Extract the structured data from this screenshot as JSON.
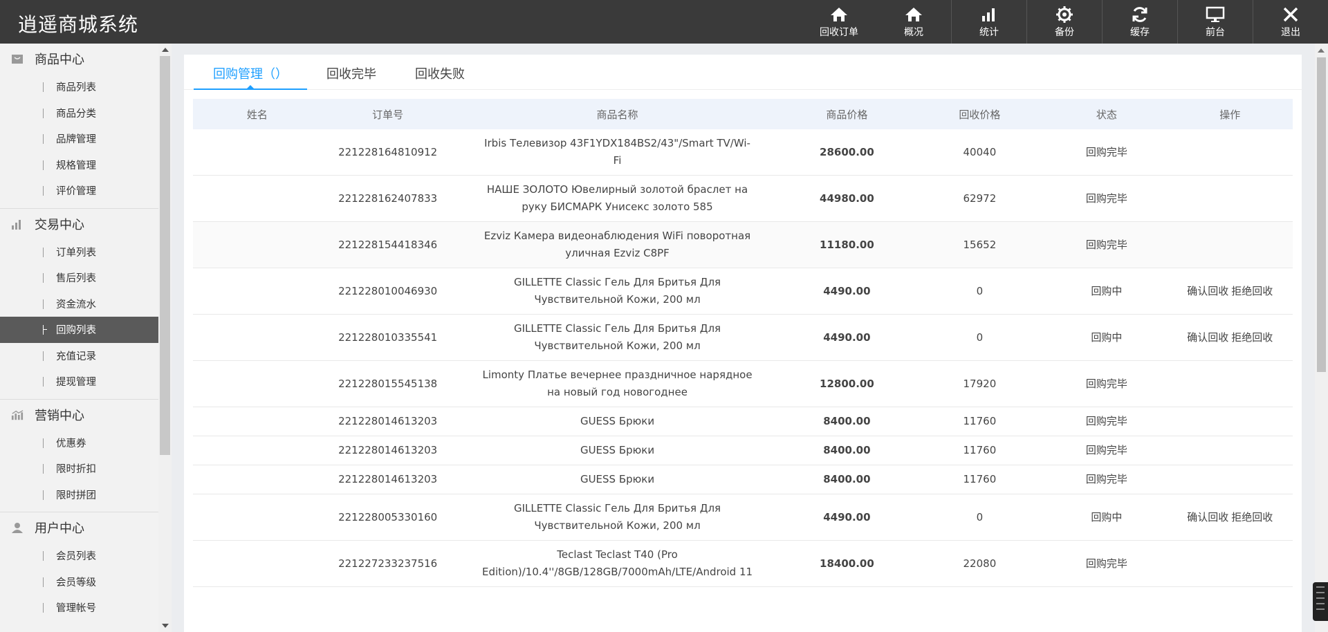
{
  "app": {
    "title": "逍遥商城系统"
  },
  "topnav": [
    {
      "label": "回收订单",
      "icon": "home-icon"
    },
    {
      "label": "概况",
      "icon": "home-icon"
    },
    {
      "label": "统计",
      "icon": "bar-chart-icon"
    },
    {
      "label": "备份",
      "icon": "gear-icon"
    },
    {
      "label": "缓存",
      "icon": "refresh-icon"
    },
    {
      "label": "前台",
      "icon": "monitor-icon"
    },
    {
      "label": "退出",
      "icon": "close-icon"
    }
  ],
  "sidebar": {
    "groups": [
      {
        "title": "商品中心",
        "icon": "bag-icon",
        "items": [
          "商品列表",
          "商品分类",
          "品牌管理",
          "规格管理",
          "评价管理"
        ]
      },
      {
        "title": "交易中心",
        "icon": "bar-chart-icon",
        "items": [
          "订单列表",
          "售后列表",
          "资金流水",
          "回购列表",
          "充值记录",
          "提现管理"
        ]
      },
      {
        "title": "营销中心",
        "icon": "growth-chart-icon",
        "items": [
          "优惠券",
          "限时折扣",
          "限时拼团"
        ]
      },
      {
        "title": "用户中心",
        "icon": "user-icon",
        "items": [
          "会员列表",
          "会员等级",
          "管理帐号"
        ]
      }
    ],
    "active_item": "回购列表"
  },
  "tabs": [
    {
      "label": "回购管理（）",
      "active": true
    },
    {
      "label": "回收完毕",
      "active": false
    },
    {
      "label": "回收失败",
      "active": false
    }
  ],
  "table": {
    "headers": [
      "姓名",
      "订单号",
      "商品名称",
      "商品价格",
      "回收价格",
      "状态",
      "操作"
    ],
    "rows": [
      {
        "name": "",
        "order_no": "221228164810912",
        "product": "Irbis Телевизор 43F1YDX184BS2/43\"/Smart TV/Wi-Fi",
        "price": "28600.00",
        "recycle_price": "40040",
        "status": "回购完毕",
        "confirm": "",
        "reject": ""
      },
      {
        "name": "",
        "order_no": "221228162407833",
        "product": "НАШЕ ЗОЛОТО Ювелирный золотой браслет на руку БИСМАРК Унисекс золото 585",
        "price": "44980.00",
        "recycle_price": "62972",
        "status": "回购完毕",
        "confirm": "",
        "reject": ""
      },
      {
        "name": "",
        "order_no": "221228154418346",
        "product": "Ezviz Камера видеонаблюдения WiFi поворотная уличная Ezviz C8PF",
        "price": "11180.00",
        "recycle_price": "15652",
        "status": "回购完毕",
        "confirm": "",
        "reject": ""
      },
      {
        "name": "",
        "order_no": "221228010046930",
        "product": "GILLETTE Classic Гель Для Бритья Для Чувствительной Кожи, 200 мл",
        "price": "4490.00",
        "recycle_price": "0",
        "status": "回购中",
        "confirm": "确认回收",
        "reject": "拒绝回收"
      },
      {
        "name": "",
        "order_no": "221228010335541",
        "product": "GILLETTE Classic Гель Для Бритья Для Чувствительной Кожи, 200 мл",
        "price": "4490.00",
        "recycle_price": "0",
        "status": "回购中",
        "confirm": "确认回收",
        "reject": "拒绝回收"
      },
      {
        "name": "",
        "order_no": "221228015545138",
        "product": "Limonty Платье вечернее праздничное нарядное на новый год новогоднее",
        "price": "12800.00",
        "recycle_price": "17920",
        "status": "回购完毕",
        "confirm": "",
        "reject": ""
      },
      {
        "name": "",
        "order_no": "221228014613203",
        "product": "GUESS Брюки",
        "price": "8400.00",
        "recycle_price": "11760",
        "status": "回购完毕",
        "confirm": "",
        "reject": ""
      },
      {
        "name": "",
        "order_no": "221228014613203",
        "product": "GUESS Брюки",
        "price": "8400.00",
        "recycle_price": "11760",
        "status": "回购完毕",
        "confirm": "",
        "reject": ""
      },
      {
        "name": "",
        "order_no": "221228014613203",
        "product": "GUESS Брюки",
        "price": "8400.00",
        "recycle_price": "11760",
        "status": "回购完毕",
        "confirm": "",
        "reject": ""
      },
      {
        "name": "",
        "order_no": "221228005330160",
        "product": "GILLETTE Classic Гель Для Бритья Для Чувствительной Кожи, 200 мл",
        "price": "4490.00",
        "recycle_price": "0",
        "status": "回购中",
        "confirm": "确认回收",
        "reject": "拒绝回收"
      },
      {
        "name": "",
        "order_no": "221227233237516",
        "product": "Teclast Teclast T40 (Pro Edition)/10.4''/8GB/128GB/7000mAh/LTE/Android 11",
        "price": "18400.00",
        "recycle_price": "22080",
        "status": "回购完毕",
        "confirm": "",
        "reject": ""
      }
    ]
  },
  "colors": {
    "accent": "#1e9fff",
    "success": "#5fb85f",
    "topbar": "#3a3a3a",
    "sidebar_active": "#5a5a5a"
  }
}
